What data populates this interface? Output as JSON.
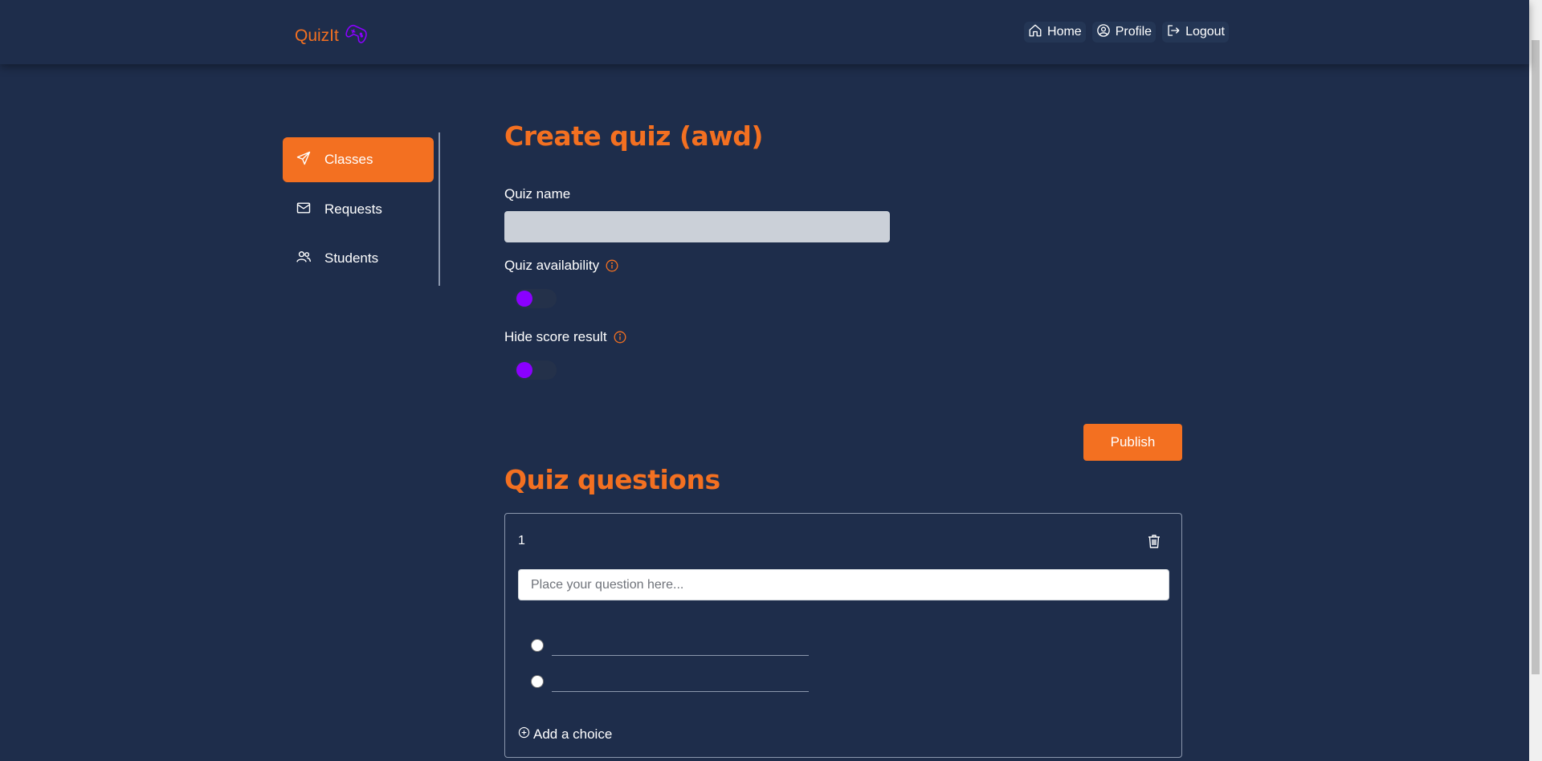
{
  "app": {
    "logo_text": "QuizIt",
    "logo_icon": "gamepad-icon",
    "brand_color": "#f37021",
    "accent_color": "#8a00ff"
  },
  "nav": {
    "home": "Home",
    "profile": "Profile",
    "logout": "Logout"
  },
  "sidebar": {
    "items": [
      {
        "label": "Classes",
        "icon": "send-icon",
        "active": true
      },
      {
        "label": "Requests",
        "icon": "mail-icon",
        "active": false
      },
      {
        "label": "Students",
        "icon": "users-icon",
        "active": false
      }
    ]
  },
  "form": {
    "title": "Create quiz (awd)",
    "quiz_name_label": "Quiz name",
    "quiz_name_value": "",
    "availability_label": "Quiz availability",
    "availability_on": false,
    "hide_score_label": "Hide score result",
    "hide_score_on": false,
    "publish_label": "Publish"
  },
  "questions": {
    "heading": "Quiz questions",
    "items": [
      {
        "number": "1",
        "placeholder": "Place your question here...",
        "choices": [
          "",
          ""
        ],
        "add_choice_label": "Add a choice"
      }
    ]
  }
}
